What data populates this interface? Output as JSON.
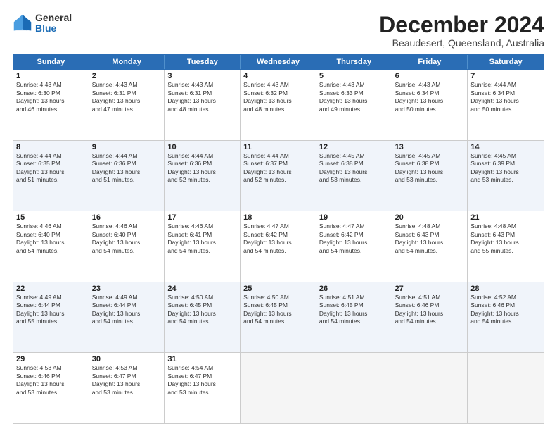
{
  "header": {
    "logo_general": "General",
    "logo_blue": "Blue",
    "month_title": "December 2024",
    "location": "Beaudesert, Queensland, Australia"
  },
  "days_of_week": [
    "Sunday",
    "Monday",
    "Tuesday",
    "Wednesday",
    "Thursday",
    "Friday",
    "Saturday"
  ],
  "rows": [
    [
      {
        "day": "1",
        "lines": [
          "Sunrise: 4:43 AM",
          "Sunset: 6:30 PM",
          "Daylight: 13 hours",
          "and 46 minutes."
        ]
      },
      {
        "day": "2",
        "lines": [
          "Sunrise: 4:43 AM",
          "Sunset: 6:31 PM",
          "Daylight: 13 hours",
          "and 47 minutes."
        ]
      },
      {
        "day": "3",
        "lines": [
          "Sunrise: 4:43 AM",
          "Sunset: 6:31 PM",
          "Daylight: 13 hours",
          "and 48 minutes."
        ]
      },
      {
        "day": "4",
        "lines": [
          "Sunrise: 4:43 AM",
          "Sunset: 6:32 PM",
          "Daylight: 13 hours",
          "and 48 minutes."
        ]
      },
      {
        "day": "5",
        "lines": [
          "Sunrise: 4:43 AM",
          "Sunset: 6:33 PM",
          "Daylight: 13 hours",
          "and 49 minutes."
        ]
      },
      {
        "day": "6",
        "lines": [
          "Sunrise: 4:43 AM",
          "Sunset: 6:34 PM",
          "Daylight: 13 hours",
          "and 50 minutes."
        ]
      },
      {
        "day": "7",
        "lines": [
          "Sunrise: 4:44 AM",
          "Sunset: 6:34 PM",
          "Daylight: 13 hours",
          "and 50 minutes."
        ]
      }
    ],
    [
      {
        "day": "8",
        "lines": [
          "Sunrise: 4:44 AM",
          "Sunset: 6:35 PM",
          "Daylight: 13 hours",
          "and 51 minutes."
        ]
      },
      {
        "day": "9",
        "lines": [
          "Sunrise: 4:44 AM",
          "Sunset: 6:36 PM",
          "Daylight: 13 hours",
          "and 51 minutes."
        ]
      },
      {
        "day": "10",
        "lines": [
          "Sunrise: 4:44 AM",
          "Sunset: 6:36 PM",
          "Daylight: 13 hours",
          "and 52 minutes."
        ]
      },
      {
        "day": "11",
        "lines": [
          "Sunrise: 4:44 AM",
          "Sunset: 6:37 PM",
          "Daylight: 13 hours",
          "and 52 minutes."
        ]
      },
      {
        "day": "12",
        "lines": [
          "Sunrise: 4:45 AM",
          "Sunset: 6:38 PM",
          "Daylight: 13 hours",
          "and 53 minutes."
        ]
      },
      {
        "day": "13",
        "lines": [
          "Sunrise: 4:45 AM",
          "Sunset: 6:38 PM",
          "Daylight: 13 hours",
          "and 53 minutes."
        ]
      },
      {
        "day": "14",
        "lines": [
          "Sunrise: 4:45 AM",
          "Sunset: 6:39 PM",
          "Daylight: 13 hours",
          "and 53 minutes."
        ]
      }
    ],
    [
      {
        "day": "15",
        "lines": [
          "Sunrise: 4:46 AM",
          "Sunset: 6:40 PM",
          "Daylight: 13 hours",
          "and 54 minutes."
        ]
      },
      {
        "day": "16",
        "lines": [
          "Sunrise: 4:46 AM",
          "Sunset: 6:40 PM",
          "Daylight: 13 hours",
          "and 54 minutes."
        ]
      },
      {
        "day": "17",
        "lines": [
          "Sunrise: 4:46 AM",
          "Sunset: 6:41 PM",
          "Daylight: 13 hours",
          "and 54 minutes."
        ]
      },
      {
        "day": "18",
        "lines": [
          "Sunrise: 4:47 AM",
          "Sunset: 6:42 PM",
          "Daylight: 13 hours",
          "and 54 minutes."
        ]
      },
      {
        "day": "19",
        "lines": [
          "Sunrise: 4:47 AM",
          "Sunset: 6:42 PM",
          "Daylight: 13 hours",
          "and 54 minutes."
        ]
      },
      {
        "day": "20",
        "lines": [
          "Sunrise: 4:48 AM",
          "Sunset: 6:43 PM",
          "Daylight: 13 hours",
          "and 54 minutes."
        ]
      },
      {
        "day": "21",
        "lines": [
          "Sunrise: 4:48 AM",
          "Sunset: 6:43 PM",
          "Daylight: 13 hours",
          "and 55 minutes."
        ]
      }
    ],
    [
      {
        "day": "22",
        "lines": [
          "Sunrise: 4:49 AM",
          "Sunset: 6:44 PM",
          "Daylight: 13 hours",
          "and 55 minutes."
        ]
      },
      {
        "day": "23",
        "lines": [
          "Sunrise: 4:49 AM",
          "Sunset: 6:44 PM",
          "Daylight: 13 hours",
          "and 54 minutes."
        ]
      },
      {
        "day": "24",
        "lines": [
          "Sunrise: 4:50 AM",
          "Sunset: 6:45 PM",
          "Daylight: 13 hours",
          "and 54 minutes."
        ]
      },
      {
        "day": "25",
        "lines": [
          "Sunrise: 4:50 AM",
          "Sunset: 6:45 PM",
          "Daylight: 13 hours",
          "and 54 minutes."
        ]
      },
      {
        "day": "26",
        "lines": [
          "Sunrise: 4:51 AM",
          "Sunset: 6:45 PM",
          "Daylight: 13 hours",
          "and 54 minutes."
        ]
      },
      {
        "day": "27",
        "lines": [
          "Sunrise: 4:51 AM",
          "Sunset: 6:46 PM",
          "Daylight: 13 hours",
          "and 54 minutes."
        ]
      },
      {
        "day": "28",
        "lines": [
          "Sunrise: 4:52 AM",
          "Sunset: 6:46 PM",
          "Daylight: 13 hours",
          "and 54 minutes."
        ]
      }
    ],
    [
      {
        "day": "29",
        "lines": [
          "Sunrise: 4:53 AM",
          "Sunset: 6:46 PM",
          "Daylight: 13 hours",
          "and 53 minutes."
        ]
      },
      {
        "day": "30",
        "lines": [
          "Sunrise: 4:53 AM",
          "Sunset: 6:47 PM",
          "Daylight: 13 hours",
          "and 53 minutes."
        ]
      },
      {
        "day": "31",
        "lines": [
          "Sunrise: 4:54 AM",
          "Sunset: 6:47 PM",
          "Daylight: 13 hours",
          "and 53 minutes."
        ]
      },
      {
        "day": "",
        "lines": []
      },
      {
        "day": "",
        "lines": []
      },
      {
        "day": "",
        "lines": []
      },
      {
        "day": "",
        "lines": []
      }
    ]
  ],
  "row_alt": [
    false,
    true,
    false,
    true,
    false
  ]
}
